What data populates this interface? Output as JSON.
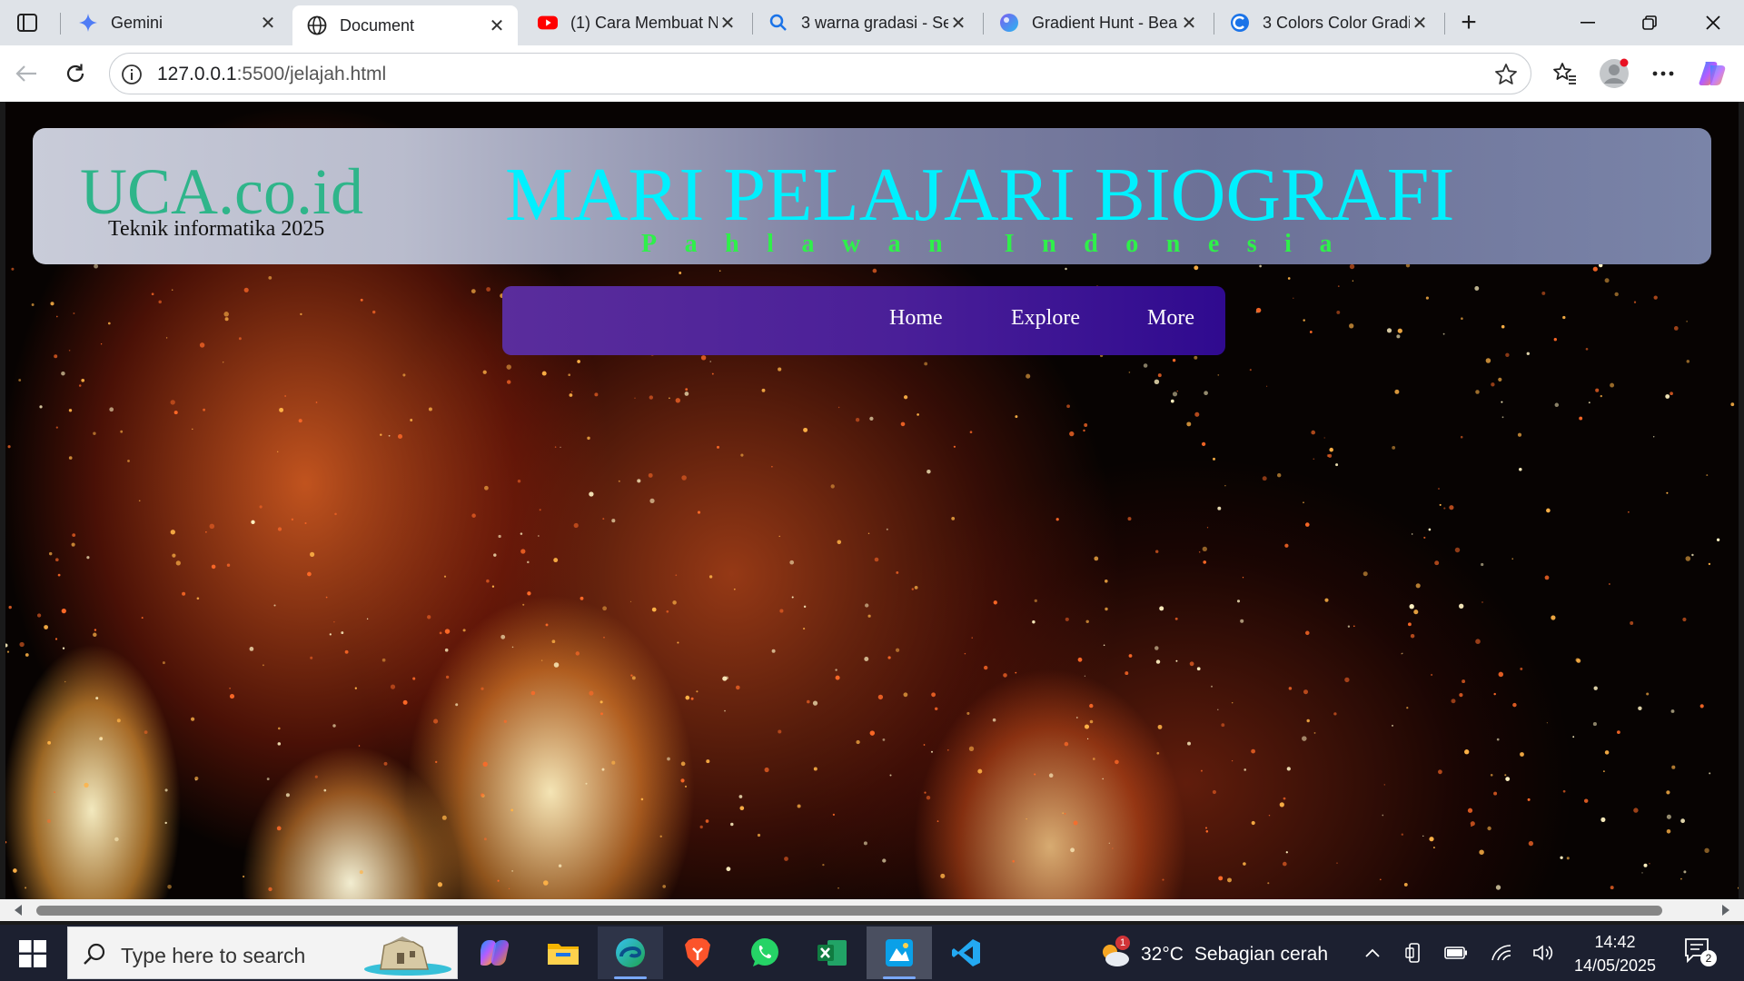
{
  "browser": {
    "tabs": [
      {
        "title": "Gemini",
        "icon": "gemini-icon",
        "active": false
      },
      {
        "title": "Document",
        "icon": "globe-icon",
        "active": true
      },
      {
        "title": "(1) Cara Membuat N",
        "icon": "youtube-icon",
        "active": false
      },
      {
        "title": "3 warna gradasi - Se",
        "icon": "search-icon",
        "active": false
      },
      {
        "title": "Gradient Hunt - Bea",
        "icon": "gradient-hunt-icon",
        "active": false
      },
      {
        "title": "3 Colors Color Gradi",
        "icon": "colors-site-icon",
        "active": false
      }
    ],
    "address": {
      "host": "127.0.0.1",
      "path": ":5500/jelajah.html"
    }
  },
  "page": {
    "brand": "UCA.co.id",
    "brand_sub": "Teknik informatika 2025",
    "headline": "MARI PELAJARI BIOGRAFI",
    "subline": "Pahlawan Indonesia",
    "nav": [
      {
        "label": "Home"
      },
      {
        "label": "Explore"
      },
      {
        "label": "More"
      }
    ],
    "colors": {
      "brand": "#2fb58a",
      "headline": "#00f0ff",
      "subline": "#2ff04a",
      "nav_start": "#5a2d9c",
      "nav_end": "#2f0a8f"
    }
  },
  "taskbar": {
    "search_placeholder": "Type here to search",
    "apps": [
      "copilot-icon",
      "file-explorer-icon",
      "edge-icon",
      "brave-icon",
      "whatsapp-icon",
      "excel-icon",
      "paint-icon",
      "vscode-icon"
    ],
    "weather": {
      "temp": "32°C",
      "desc": "Sebagian cerah",
      "badge": "1"
    },
    "time": "14:42",
    "date": "14/05/2025",
    "notifications": "2"
  }
}
